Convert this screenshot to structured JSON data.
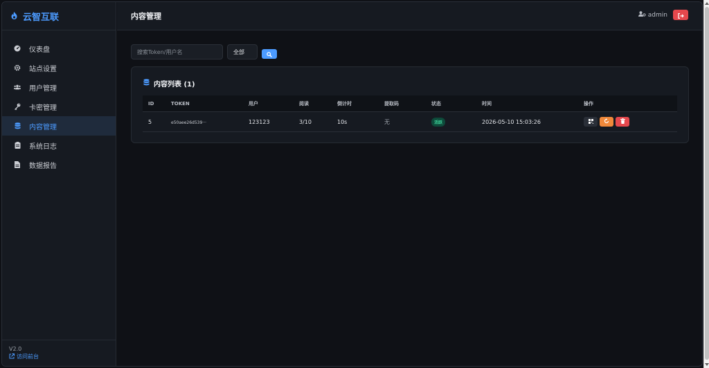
{
  "brand": {
    "name": "云智互联",
    "accent": "#4c9bff"
  },
  "sidebar": {
    "items": [
      {
        "label": "仪表盘",
        "icon": "dashboard-icon"
      },
      {
        "label": "站点设置",
        "icon": "gear-icon"
      },
      {
        "label": "用户管理",
        "icon": "users-icon"
      },
      {
        "label": "卡密管理",
        "icon": "key-icon"
      },
      {
        "label": "内容管理",
        "icon": "database-icon",
        "active": true
      },
      {
        "label": "系统日志",
        "icon": "clipboard-icon"
      },
      {
        "label": "数据报告",
        "icon": "file-icon"
      }
    ],
    "version": "V2.0",
    "front_link": "访问前台"
  },
  "header": {
    "title": "内容管理",
    "user": "admin"
  },
  "toolbar": {
    "search_placeholder": "搜索Token/用户名",
    "filter_value": "全部"
  },
  "card": {
    "title": "内容列表 (1)"
  },
  "table": {
    "columns": [
      "ID",
      "TOKEN",
      "用户",
      "阅读",
      "倒计时",
      "提取码",
      "状态",
      "时间",
      "操作"
    ],
    "rows": [
      {
        "id": "5",
        "token": "e50aee26d539···",
        "user": "123123",
        "read": "3/10",
        "countdown": "10s",
        "code": "无",
        "status": "活跃",
        "time": "2026-05-10 15:03:26"
      }
    ]
  },
  "colors": {
    "danger": "#e5484d",
    "warning": "#f0893b",
    "success": "#3fd39a"
  }
}
